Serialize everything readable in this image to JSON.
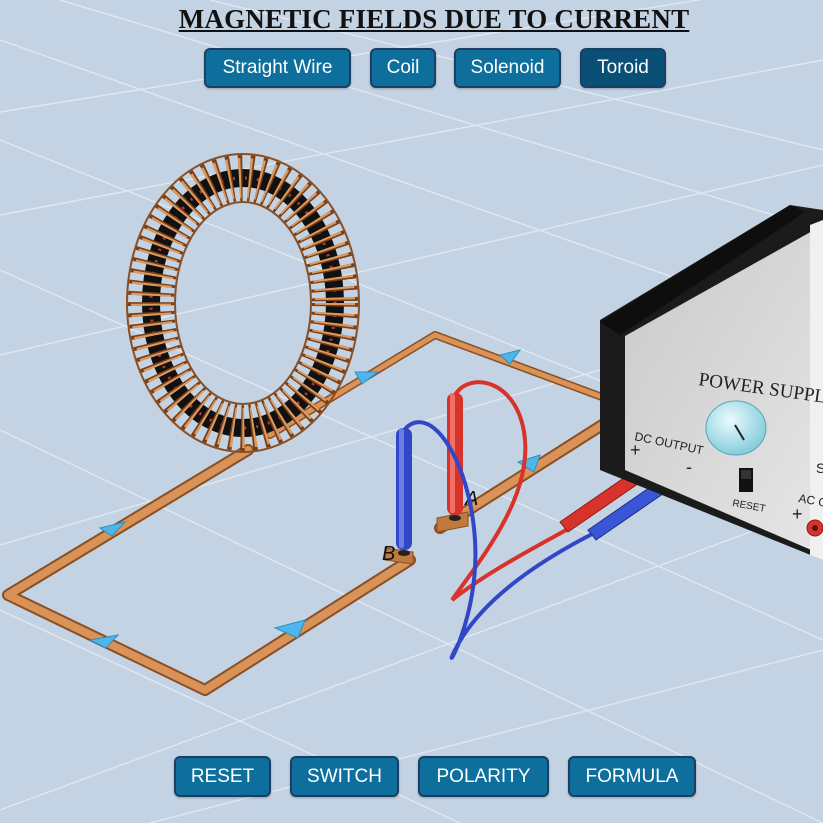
{
  "title": "MAGNETIC FIELDS DUE TO CURRENT",
  "tabs": [
    {
      "label": "Straight Wire",
      "active": false
    },
    {
      "label": "Coil",
      "active": false
    },
    {
      "label": "Solenoid",
      "active": false
    },
    {
      "label": "Toroid",
      "active": true
    }
  ],
  "controls": [
    {
      "label": "RESET"
    },
    {
      "label": "SWITCH"
    },
    {
      "label": "POLARITY"
    },
    {
      "label": "FORMULA"
    }
  ],
  "power_supply": {
    "name": "POWER SUPPLY",
    "dc_output_label": "DC OUTPUT",
    "plus_sign": "+",
    "minus_sign": "-",
    "reset_label": "RESET",
    "ac_label": "AC O",
    "s_label": "S"
  },
  "terminals": {
    "a": "A",
    "b": "B"
  },
  "colors": {
    "background": "#c3d3e4",
    "button": "#0f6f9c",
    "button_active": "#0a4f76",
    "copper": "#c27a3c",
    "red_lead": "#d8332a",
    "blue_lead": "#3247c8",
    "current_arrow": "#4fb6ea"
  }
}
